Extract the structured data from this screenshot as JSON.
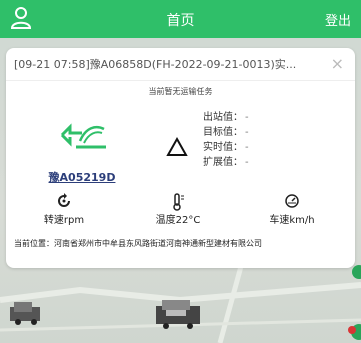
{
  "header": {
    "title": "首页",
    "logout_label": "登出"
  },
  "message": {
    "text": "[09-21 07:58]豫A06858D(FH-2022-09-21-0013)实...",
    "close_symbol": "×"
  },
  "task_status": "当前暂无运输任务",
  "truck": {
    "plate": "豫A05219D",
    "logo_icon": "truck-brand-icon"
  },
  "status_icon": "triangle-outline-icon",
  "info": {
    "items": [
      {
        "label": "出站值：",
        "value": "-"
      },
      {
        "label": "目标值：",
        "value": "-"
      },
      {
        "label": "实时值：",
        "value": "-"
      },
      {
        "label": "扩展值：",
        "value": "-"
      }
    ]
  },
  "gauges": [
    {
      "icon": "rotation-icon",
      "label": "转速rpm"
    },
    {
      "icon": "thermometer-icon",
      "label": "温度22°C"
    },
    {
      "icon": "speedometer-icon",
      "label": "车速km/h"
    }
  ],
  "location": {
    "text": "当前位置：河南省郑州市中牟县东风路街道河南神通新型建材有限公司"
  },
  "colors": {
    "accent": "#2fbf69",
    "plate": "#2c3e7a",
    "badge_green": "#2aa55a",
    "badge_red": "#d93535"
  }
}
